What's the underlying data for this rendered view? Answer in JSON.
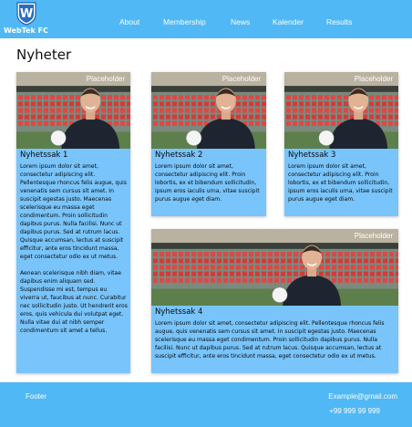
{
  "site": {
    "logo_text": "WebTek FC",
    "logo_letter": "W"
  },
  "nav": [
    {
      "label": "About"
    },
    {
      "label": "Membership"
    },
    {
      "label": "News"
    },
    {
      "label": "Kalender"
    },
    {
      "label": "Results"
    }
  ],
  "page": {
    "title": "Nyheter"
  },
  "placeholder_label": "Placeholder",
  "articles": [
    {
      "title": "Nyhetssak 1",
      "paragraphs": [
        "Lorem ipsum dolor sit amet, consectetur adipiscing elit. Pellentesque rhoncus felis augue, quis venenatis sem cursus sit amet. In suscipit egestas justo. Maecenas scelerisque eu massa eget condimentum. Proin sollicitudin dapibus purus. Nulla facilisi. Nunc ut dapibus purus. Sed at rutrum lacus. Quisque accumsan, lectus at suscipit efficitur, ante eros tincidunt massa, eget consectetur odio ex ut metus.",
        "Aenean scelerisque nibh diam, vitae dapibus enim aliquam sed. Suspendisse mi est, tempus eu viverra ut, faucibus at nunc. Curabitur nec sollicitudin justo. Ut hendrerit eros eros, quis vehicula dui volutpat eget. Nulla vitae dui at nibh semper condimentum sit amet a tellus."
      ]
    },
    {
      "title": "Nyhetssak 2",
      "paragraphs": [
        "Lorem ipsum dolor sit amet, consectetur adipiscing elit. Proin lobortis, ex et bibendum sollicitudin, ipsum eros iaculis urna, vitae suscipit purus augue eget diam."
      ]
    },
    {
      "title": "Nyhetssak 3",
      "paragraphs": [
        "Lorem ipsum dolor sit amet, consectetur adipiscing elit. Proin lobortis, ex et bibendum sollicitudin, ipsum eros iaculis urna, vitae suscipit purus augue eget diam."
      ]
    },
    {
      "title": "Nyhetssak 4",
      "paragraphs": [
        "Lorem ipsum dolor sit amet, consectetur adipiscing elit. Pellentesque rhoncus felis augue, quis venenatis sem cursus sit amet. In suscipit egestas justo. Maecenas scelerisque eu massa eget condimentum. Proin sollicitudin dapibus purus. Nulla facilisi. Nunc ut dapibus purus. Sed at rutrum lacus. Quisque accumsan, lectus at suscipit efficitur, ante eros tincidunt massa, eget consectetur odio ex ut metus."
      ]
    }
  ],
  "footer": {
    "label": "Footer",
    "email": "Example@gmail.com",
    "phone": "+99 999 99 999"
  },
  "colors": {
    "header_bg": "#4fb8f5",
    "card_bg": "#78c4fb",
    "footer_bg": "#4fb8f5"
  }
}
